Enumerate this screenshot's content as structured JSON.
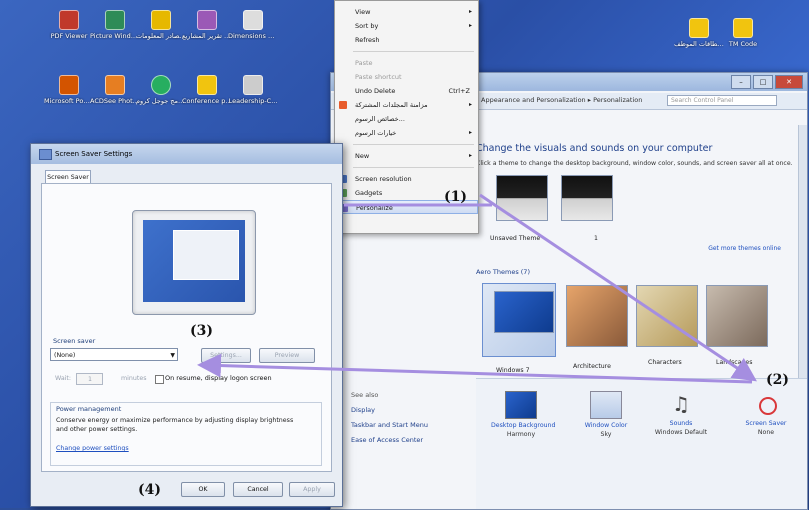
{
  "desktop": {
    "icons": [
      {
        "label": "PDF Viewer",
        "color": "#c0392b"
      },
      {
        "label": "Picture Window",
        "color": "#2e8b57"
      },
      {
        "label": "برنامج مصادر المعلومات",
        "color": "#e6b800"
      },
      {
        "label": "كتابة تقرير المشاريع",
        "color": "#9b59b6"
      },
      {
        "label": "Dimensions of Brand Conc.",
        "color": "#dddddd"
      },
      {
        "label": "Microsoft PowerPoi...",
        "color": "#d35400"
      },
      {
        "label": "ACDSee Photo Ma...",
        "color": "#e67e22"
      },
      {
        "label": "برنامج جوجل كروم",
        "color": "#27ae60"
      },
      {
        "label": "Conference papers - You...",
        "color": "#f1c40f"
      },
      {
        "label": "Leadership-C...",
        "color": "#cccccc"
      }
    ],
    "right_icons": [
      {
        "label": "توثيق بطاقات الموظف",
        "color": "#f1c40f"
      },
      {
        "label": "TM Code",
        "color": "#f1c40f"
      }
    ]
  },
  "context_menu": {
    "items": [
      {
        "label": "View",
        "submenu": true,
        "disabled": false
      },
      {
        "label": "Sort by",
        "submenu": true,
        "disabled": false
      },
      {
        "label": "Refresh",
        "submenu": false,
        "disabled": false
      },
      {
        "label": "Paste",
        "submenu": false,
        "disabled": true
      },
      {
        "label": "Paste shortcut",
        "submenu": false,
        "disabled": true
      },
      {
        "label": "Undo Delete",
        "shortcut": "Ctrl+Z",
        "submenu": false,
        "disabled": false
      },
      {
        "label": "مزامنة المجلدات المشتركة",
        "submenu": true,
        "disabled": false
      },
      {
        "label": "خصائص الرسوم...",
        "submenu": false,
        "disabled": false
      },
      {
        "label": "خيارات الرسوم",
        "submenu": true,
        "disabled": false
      },
      {
        "label": "New",
        "submenu": true,
        "disabled": false
      },
      {
        "label": "Screen resolution",
        "submenu": false,
        "disabled": false
      },
      {
        "label": "Gadgets",
        "submenu": false,
        "disabled": false
      },
      {
        "label": "Personalize",
        "submenu": false,
        "disabled": false
      }
    ]
  },
  "control_panel": {
    "address": "Appearance and Personalization ▸ Personalization",
    "search_placeholder": "Search Control Panel",
    "heading": "Change the visuals and sounds on your computer",
    "subheading": "Click a theme to change the desktop background, window color, sounds, and screen saver all at once.",
    "my_themes": [
      {
        "label": "Unsaved Theme"
      },
      {
        "label": "1"
      }
    ],
    "more_online": "Get more themes online",
    "aero_title": "Aero Themes (7)",
    "aero_themes": [
      {
        "label": "Windows 7"
      },
      {
        "label": "Architecture"
      },
      {
        "label": "Characters"
      },
      {
        "label": "Landscapes"
      }
    ],
    "see_also": {
      "header": "See also",
      "links": [
        "Display",
        "Taskbar and Start Menu",
        "Ease of Access Center"
      ]
    },
    "bottom": [
      {
        "title": "Desktop Background",
        "sub": "Harmony"
      },
      {
        "title": "Window Color",
        "sub": "Sky"
      },
      {
        "title": "Sounds",
        "sub": "Windows Default"
      },
      {
        "title": "Screen Saver",
        "sub": "None"
      }
    ],
    "window_buttons": {
      "minimize": "–",
      "maximize": "□",
      "close": "✕"
    }
  },
  "screensaver_dialog": {
    "title": "Screen Saver Settings",
    "tab": "Screen Saver",
    "group_label": "Screen saver",
    "selected": "(None)",
    "settings_button": "Settings...",
    "preview_button": "Preview",
    "wait_label": "Wait:",
    "wait_value": "1",
    "minutes_label": "minutes",
    "resume_label": "On resume, display logon screen",
    "power_title": "Power management",
    "power_desc": "Conserve energy or maximize performance by adjusting display brightness and other power settings.",
    "power_link": "Change power settings",
    "ok": "OK",
    "cancel": "Cancel",
    "apply": "Apply"
  },
  "annotations": {
    "a1": "(1)",
    "a2": "(2)",
    "a3": "(3)",
    "a4": "(4)"
  },
  "colors": {
    "arrow": "#a58ee0",
    "link": "#1e4fbf",
    "heading": "#1e3f8a"
  }
}
